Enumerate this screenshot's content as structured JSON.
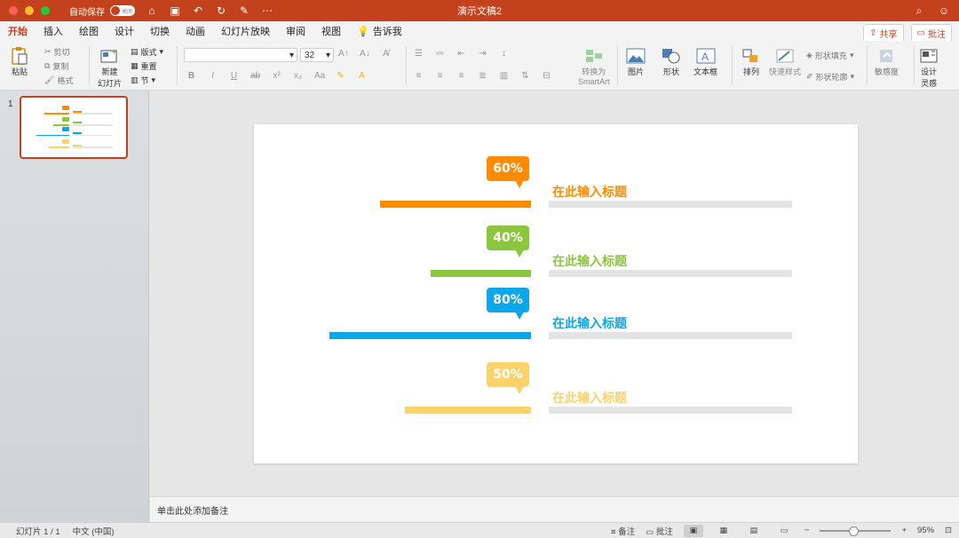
{
  "titlebar": {
    "autosave_label": "自动保存",
    "autosave_state": "关闭",
    "doc_title": "演示文稿2"
  },
  "tabs": [
    {
      "label": "开始",
      "active": true
    },
    {
      "label": "插入"
    },
    {
      "label": "绘图"
    },
    {
      "label": "设计"
    },
    {
      "label": "切换"
    },
    {
      "label": "动画"
    },
    {
      "label": "幻灯片放映"
    },
    {
      "label": "审阅"
    },
    {
      "label": "视图"
    }
  ],
  "tell_me": "告诉我",
  "share": {
    "share_label": "共享",
    "comment_label": "批注"
  },
  "ribbon": {
    "paste": "粘贴",
    "cut": "剪切",
    "copy": "复制",
    "format": "格式",
    "new_slide_1": "新建",
    "new_slide_2": "幻灯片",
    "layout": "版式",
    "reset": "重置",
    "section": "节",
    "font_size": "32",
    "convert_1": "转换为",
    "convert_2": "SmartArt",
    "picture": "图片",
    "shape": "形状",
    "textbox": "文本框",
    "arrange": "排列",
    "quick_styles": "快速样式",
    "shape_fill": "形状填充",
    "shape_outline": "形状轮廓",
    "sensitivity": "敏感度",
    "designer_1": "设计",
    "designer_2": "灵感"
  },
  "sidebar": {
    "slide_number": "1"
  },
  "slide": {
    "rows": [
      {
        "percent": "60%",
        "value": 0.6,
        "title": "在此输入标题",
        "color": "#ff8c00"
      },
      {
        "percent": "40%",
        "value": 0.4,
        "title": "在此输入标题",
        "color": "#8cc63f"
      },
      {
        "percent": "80%",
        "value": 0.8,
        "title": "在此输入标题",
        "color": "#0ea5e9"
      },
      {
        "percent": "50%",
        "value": 0.5,
        "title": "在此输入标题",
        "color": "#fcd36a"
      }
    ]
  },
  "notes": {
    "placeholder": "单击此处添加备注"
  },
  "status": {
    "slide_info": "幻灯片 1 / 1",
    "language": "中文 (中国)",
    "notes_btn": "备注",
    "comments_btn": "批注",
    "zoom": "95%"
  }
}
